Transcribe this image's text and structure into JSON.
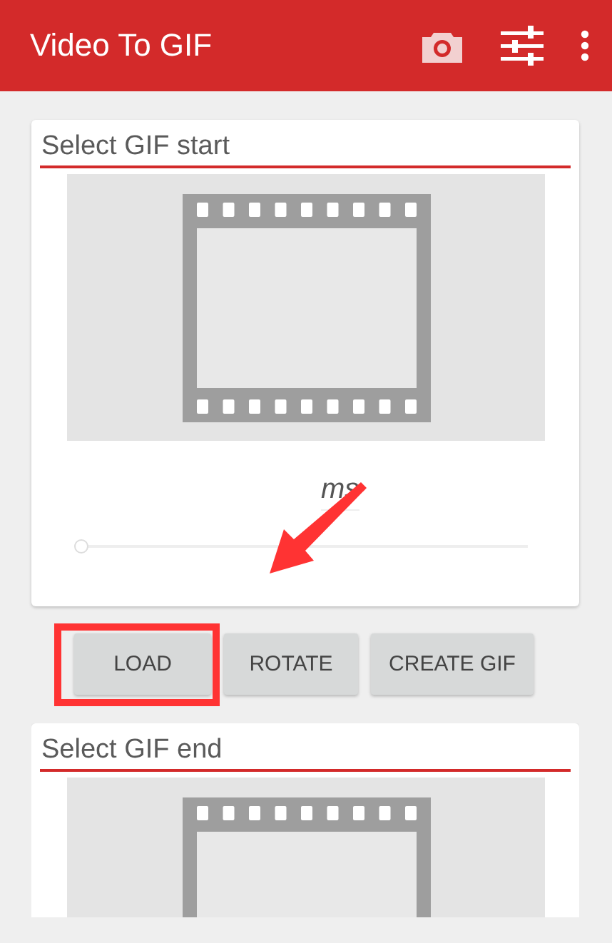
{
  "app_bar": {
    "title": "Video To GIF"
  },
  "start_card": {
    "title": "Select GIF start",
    "unit": "ms",
    "slider": {
      "level": 0
    }
  },
  "buttons": [
    {
      "label": "LOAD",
      "highlighted": true
    },
    {
      "label": "ROTATE",
      "highlighted": false
    },
    {
      "label": "CREATE GIF",
      "highlighted": false
    }
  ],
  "end_card": {
    "title": "Select GIF end"
  }
}
